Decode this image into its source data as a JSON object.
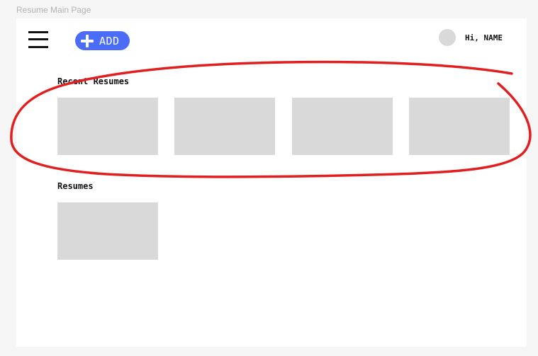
{
  "frame_label": "Resume Main Page",
  "header": {
    "menu_icon": "hamburger-menu-icon",
    "add_label": "ADD",
    "add_icon": "plus-icon",
    "greeting": "Hi, NAME",
    "accent_color": "#4a6cf7"
  },
  "sections": {
    "recent_title": "Recent Resumes",
    "recent_count": 4,
    "resumes_title": "Resumes",
    "resumes_count": 1
  },
  "annotation": {
    "shape": "hand-drawn-ellipse",
    "color": "#e02020"
  }
}
